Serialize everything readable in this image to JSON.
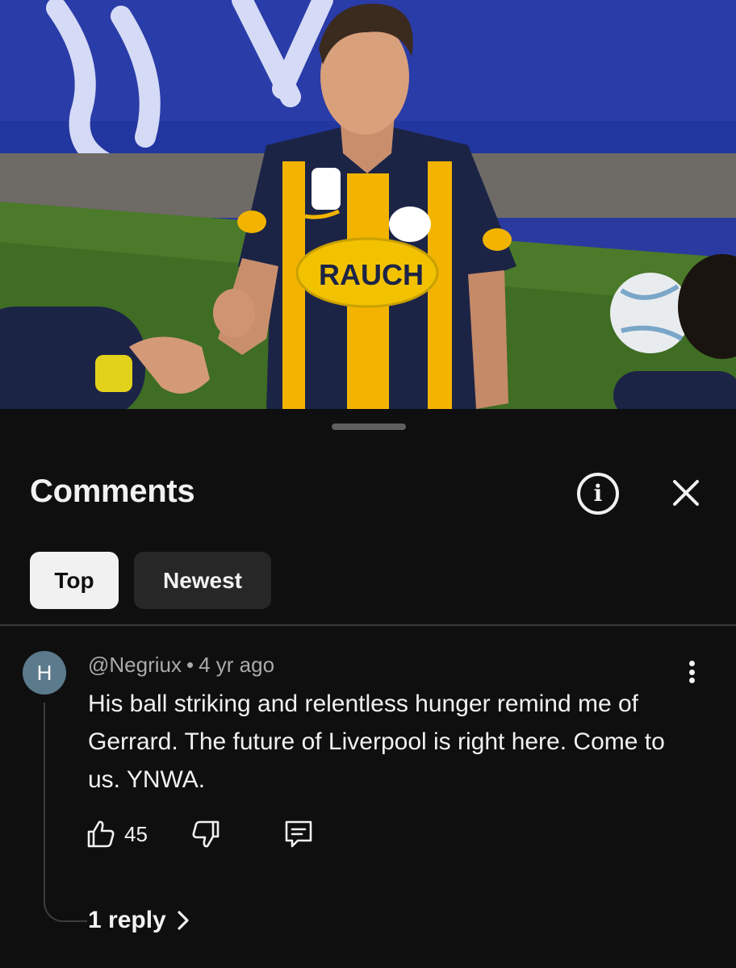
{
  "video": {
    "jersey_sponsor": "RAUCH",
    "colors": {
      "stripe_yellow": "#f2b400",
      "stripe_navy": "#1c2446",
      "pitch": "#4a7a2a",
      "board": "#2a3ca8"
    }
  },
  "panel": {
    "title": "Comments",
    "icons": {
      "info": "info-icon",
      "close": "close-icon"
    },
    "chips": [
      {
        "label": "Top",
        "selected": true
      },
      {
        "label": "Newest",
        "selected": false
      }
    ]
  },
  "comment": {
    "avatar_letter": "H",
    "avatar_color": "#5b7a8c",
    "author": "@Negriux",
    "separator": "•",
    "time": "4 yr ago",
    "text": "His ball striking and relentless hunger remind me of Gerrard. The future of Liverpool is right here. Come to us. YNWA.",
    "like_count": "45",
    "icons": {
      "like": "thumbs-up-icon",
      "dislike": "thumbs-down-icon",
      "reply": "reply-icon",
      "more": "more-vertical-icon"
    },
    "replies_label": "1 reply"
  }
}
